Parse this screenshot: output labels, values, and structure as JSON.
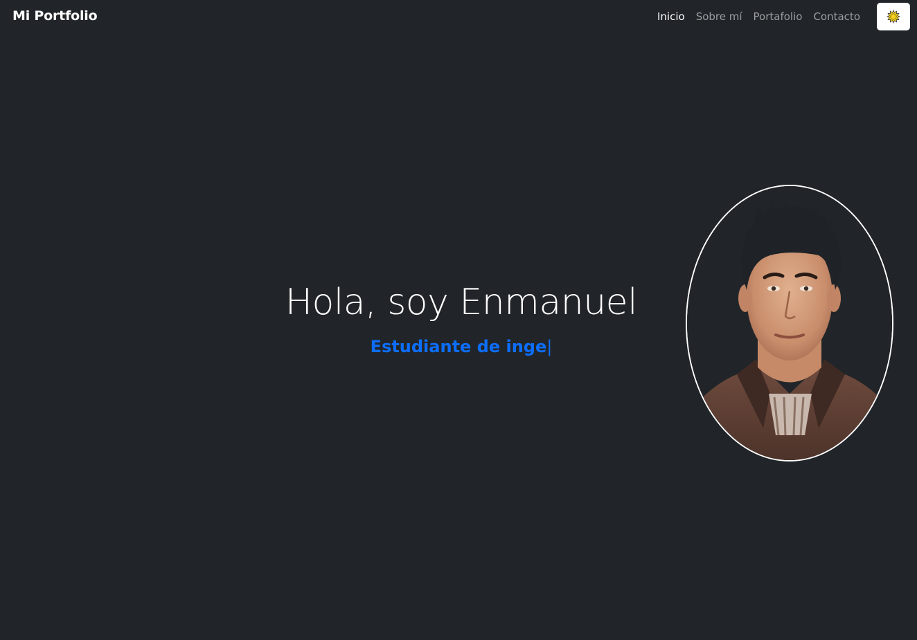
{
  "navbar": {
    "brand": "Mi Portfolio",
    "links": [
      {
        "label": "Inicio",
        "active": true
      },
      {
        "label": "Sobre mí",
        "active": false
      },
      {
        "label": "Portafolio",
        "active": false
      },
      {
        "label": "Contacto",
        "active": false
      }
    ],
    "theme_toggle_icon": "sun-icon"
  },
  "hero": {
    "title": "Hola, soy Enmanuel",
    "subtitle": "Estudiante de inge",
    "cursor": "|"
  },
  "colors": {
    "background": "#212529",
    "accent": "#0d6efd",
    "sun": "#f7d21a"
  }
}
